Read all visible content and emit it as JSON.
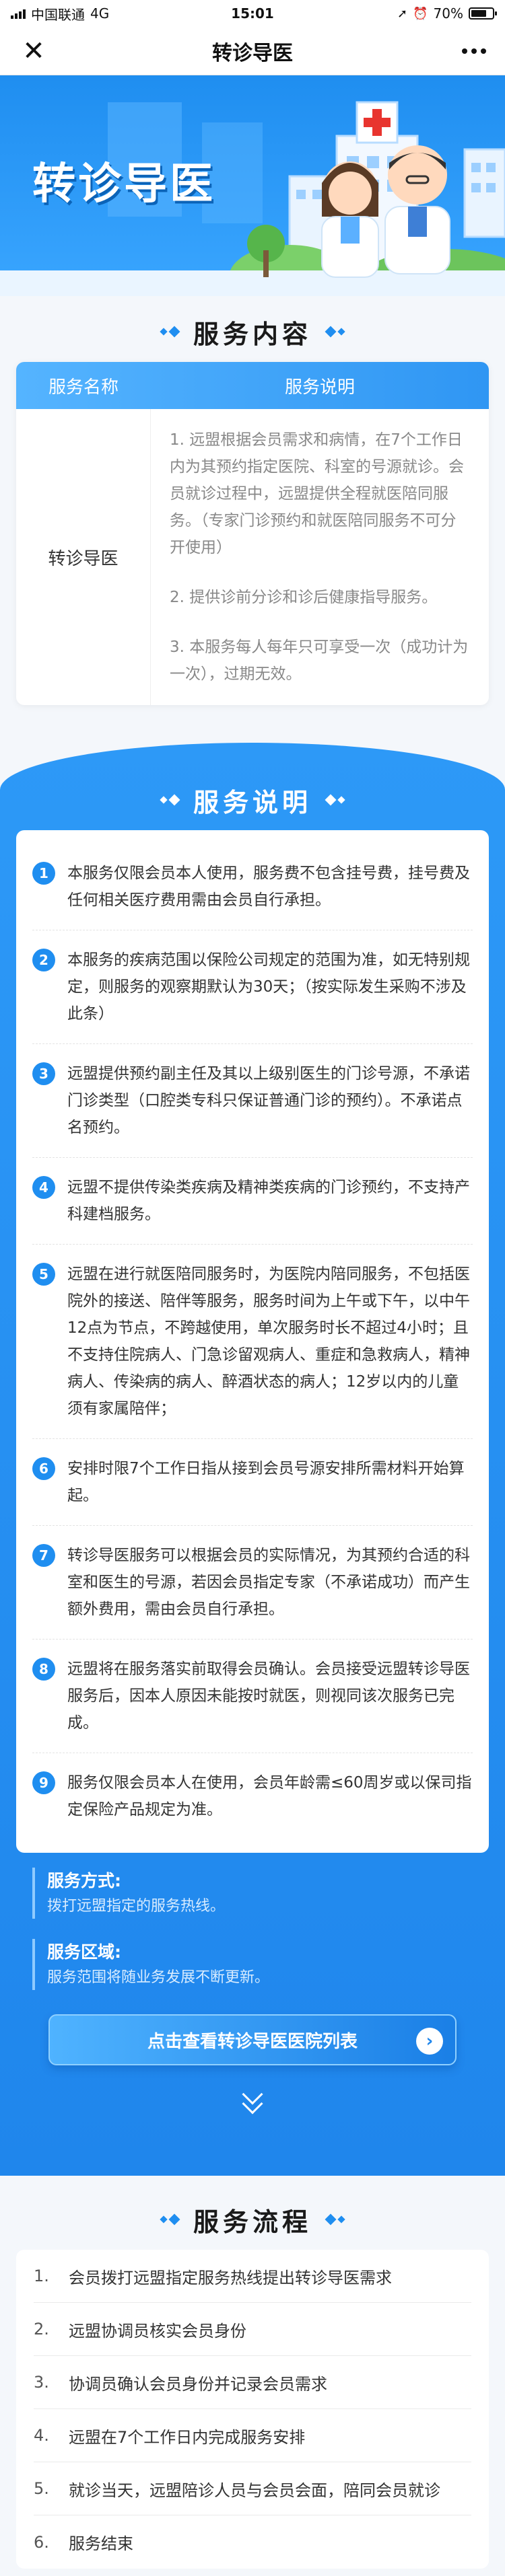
{
  "status_bar": {
    "carrier": "中国联通",
    "network": "4G",
    "time": "15:01",
    "battery": "70%"
  },
  "nav": {
    "title": "转诊导医"
  },
  "hero": {
    "title": "转诊导医"
  },
  "service_content": {
    "heading": "服务内容",
    "col_name": "服务名称",
    "col_desc": "服务说明",
    "name": "转诊导医",
    "desc": [
      "1. 远盟根据会员需求和病情，在7个工作日内为其预约指定医院、科室的号源就诊。会员就诊过程中，远盟提供全程就医陪同服务。（专家门诊预约和就医陪同服务不可分开使用）",
      "2. 提供诊前分诊和诊后健康指导服务。",
      "3. 本服务每人每年只可享受一次（成功计为一次），过期无效。"
    ]
  },
  "service_explain": {
    "heading": "服务说明",
    "rules": [
      {
        "num": "1",
        "text": "本服务仅限会员本人使用，服务费不包含挂号费，挂号费及任何相关医疗费用需由会员自行承担。"
      },
      {
        "num": "2",
        "text": "本服务的疾病范围以保险公司规定的范围为准，如无特别规定，则服务的观察期默认为30天；（按实际发生采购不涉及此条）"
      },
      {
        "num": "3",
        "text": "远盟提供预约副主任及其以上级别医生的门诊号源，不承诺门诊类型（口腔类专科只保证普通门诊的预约）。不承诺点名预约。"
      },
      {
        "num": "4",
        "text": "远盟不提供传染类疾病及精神类疾病的门诊预约，不支持产科建档服务。"
      },
      {
        "num": "5",
        "text": "远盟在进行就医陪同服务时，为医院内陪同服务，不包括医院外的接送、陪伴等服务，服务时间为上午或下午，以中午12点为节点，不跨越使用，单次服务时长不超过4小时；且不支持住院病人、门急诊留观病人、重症和急救病人，精神病人、传染病的病人、醉酒状态的病人；12岁以内的儿童须有家属陪伴；"
      },
      {
        "num": "6",
        "text": "安排时限7个工作日指从接到会员号源安排所需材料开始算起。"
      },
      {
        "num": "7",
        "text": "转诊导医服务可以根据会员的实际情况，为其预约合适的科室和医生的号源，若因会员指定专家（不承诺成功）而产生额外费用，需由会员自行承担。"
      },
      {
        "num": "8",
        "text": "远盟将在服务落实前取得会员确认。会员接受远盟转诊导医服务后，因本人原因未能按时就医，则视同该次服务已完成。"
      },
      {
        "num": "9",
        "text": "服务仅限会员本人在使用，会员年龄需≤60周岁或以保司指定保险产品规定为准。"
      }
    ],
    "method_label": "服务方式:",
    "method_value": "拨打远盟指定的服务热线。",
    "area_label": "服务区域:",
    "area_value": "服务范围将随业务发展不断更新。",
    "list_button": "点击查看转诊导医医院列表"
  },
  "process": {
    "heading": "服务流程",
    "steps": [
      {
        "num": "1.",
        "text": "会员拨打远盟指定服务热线提出转诊导医需求"
      },
      {
        "num": "2.",
        "text": "远盟协调员核实会员身份"
      },
      {
        "num": "3.",
        "text": "协调员确认会员身份并记录会员需求"
      },
      {
        "num": "4.",
        "text": "远盟在7个工作日内完成服务安排"
      },
      {
        "num": "5.",
        "text": "就诊当天，远盟陪诊人员与会员会面，陪同会员就诊"
      },
      {
        "num": "6.",
        "text": "服务结束"
      }
    ]
  },
  "colors": {
    "primary": "#1f8ef0",
    "accent_light": "#55b4ff",
    "text_dark": "#333333",
    "text_muted": "#888888"
  }
}
